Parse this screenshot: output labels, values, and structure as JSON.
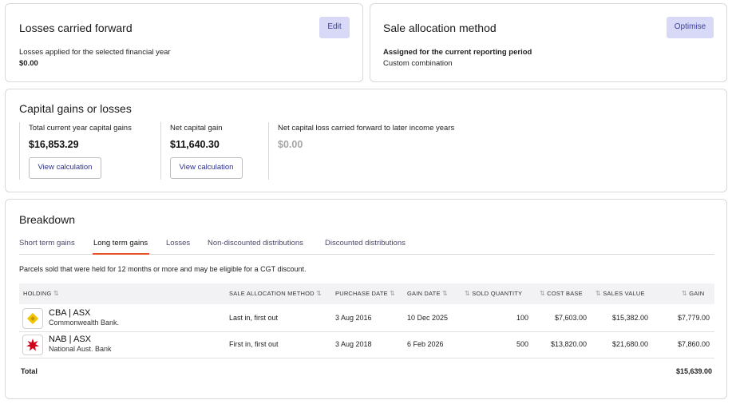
{
  "losses_card": {
    "title": "Losses carried forward",
    "edit_label": "Edit",
    "subtitle": "Losses applied for the selected financial year",
    "value": "$0.00"
  },
  "sale_card": {
    "title": "Sale allocation method",
    "optimise_label": "Optimise",
    "subtitle": "Assigned for the current reporting period",
    "value": "Custom combination"
  },
  "gains_card": {
    "title": "Capital gains or losses",
    "metrics": [
      {
        "label": "Total current year capital gains",
        "value": "$16,853.29",
        "button": "View calculation"
      },
      {
        "label": "Net capital gain",
        "value": "$11,640.30",
        "button": "View calculation"
      },
      {
        "label": "Net capital loss carried forward to later income years",
        "value": "$0.00"
      }
    ]
  },
  "breakdown": {
    "title": "Breakdown",
    "tabs": [
      {
        "label": "Short term gains"
      },
      {
        "label": "Long term gains",
        "active": true
      },
      {
        "label": "Losses"
      },
      {
        "label": "Non-discounted distributions"
      },
      {
        "label": "Discounted distributions"
      }
    ],
    "description": "Parcels sold that were held for 12 months or more and may be eligible for a CGT discount.",
    "columns": {
      "holding": "HOLDING",
      "method": "SALE ALLOCATION METHOD",
      "purchase_date": "PURCHASE DATE",
      "gain_date": "GAIN DATE",
      "sold_quantity": "SOLD QUANTITY",
      "cost_base": "COST BASE",
      "sales_value": "SALES VALUE",
      "gain": "GAIN"
    },
    "sort_icon": "⇅",
    "rows": [
      {
        "ticker": "CBA | ASX",
        "company": "Commonwealth Bank.",
        "logo_icon": "cba-diamond-icon",
        "logo_color": "#f5c400",
        "method": "Last in, first out",
        "purchase_date": "3 Aug 2016",
        "gain_date": "10 Dec 2025",
        "sold_quantity": "100",
        "cost_base": "$7,603.00",
        "sales_value": "$15,382.00",
        "gain": "$7,779.00"
      },
      {
        "ticker": "NAB | ASX",
        "company": "National Aust. Bank",
        "logo_icon": "nab-star-icon",
        "logo_color": "#d0021b",
        "method": "First in, first out",
        "purchase_date": "3 Aug 2018",
        "gain_date": "6 Feb 2026",
        "sold_quantity": "500",
        "cost_base": "$13,820.00",
        "sales_value": "$21,680.00",
        "gain": "$7,860.00"
      }
    ],
    "total_label": "Total",
    "total_value": "$15,639.00"
  }
}
